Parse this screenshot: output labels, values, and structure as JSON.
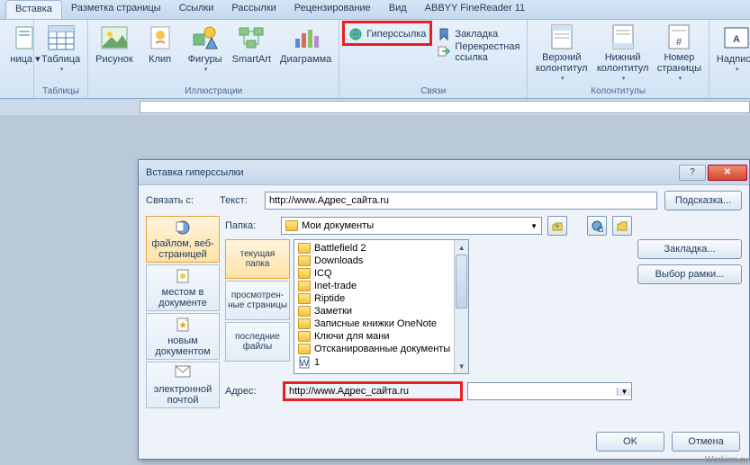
{
  "tabs": {
    "insert": "Вставка",
    "layout": "Разметка страницы",
    "refs": "Ссылки",
    "mail": "Рассылки",
    "review": "Рецензирование",
    "view": "Вид",
    "abbyy": "ABBYY FineReader 11"
  },
  "ribbon": {
    "pages_partial": "ница ▾",
    "table": "Таблица",
    "tables_group": "Таблицы",
    "picture": "Рисунок",
    "clip": "Клип",
    "shapes": "Фигуры",
    "smartart": "SmartArt",
    "chart": "Диаграмма",
    "illustrations_group": "Иллюстрации",
    "hyperlink": "Гиперссылка",
    "bookmark": "Закладка",
    "crossref": "Перекрестная ссылка",
    "links_group": "Связи",
    "header": "Верхний колонтитул",
    "footer": "Нижний колонтитул",
    "pagenum": "Номер страницы",
    "headers_group": "Колонтитулы",
    "textbox": "Надпись"
  },
  "dialog": {
    "title": "Вставка гиперссылки",
    "link_to": "Связать с:",
    "text_label": "Текст:",
    "text_value": "http://www.Адрес_сайта.ru",
    "tooltip_btn": "Подсказка...",
    "linkto": {
      "file": "файлом, веб-страницей",
      "place": "местом в документе",
      "new": "новым документом",
      "email": "электронной почтой"
    },
    "mid": {
      "current": "текущая папка",
      "browsed": "просмотрен-ные страницы",
      "recent": "последние файлы"
    },
    "lookin_label": "Папка:",
    "lookin_value": "Мои документы",
    "files": [
      "Battlefield 2",
      "Downloads",
      "ICQ",
      "Inet-trade",
      "Riptide",
      "Заметки",
      "Записные книжки OneNote",
      "Ключи для мани",
      "Отсканированные документы",
      "1"
    ],
    "bookmark_btn": "Закладка...",
    "frame_btn": "Выбор рамки...",
    "addr_label": "Адрес:",
    "addr_value": "http://www.Адрес_сайта.ru",
    "ok": "OK",
    "cancel": "Отмена"
  },
  "watermark": "Workion.ru"
}
